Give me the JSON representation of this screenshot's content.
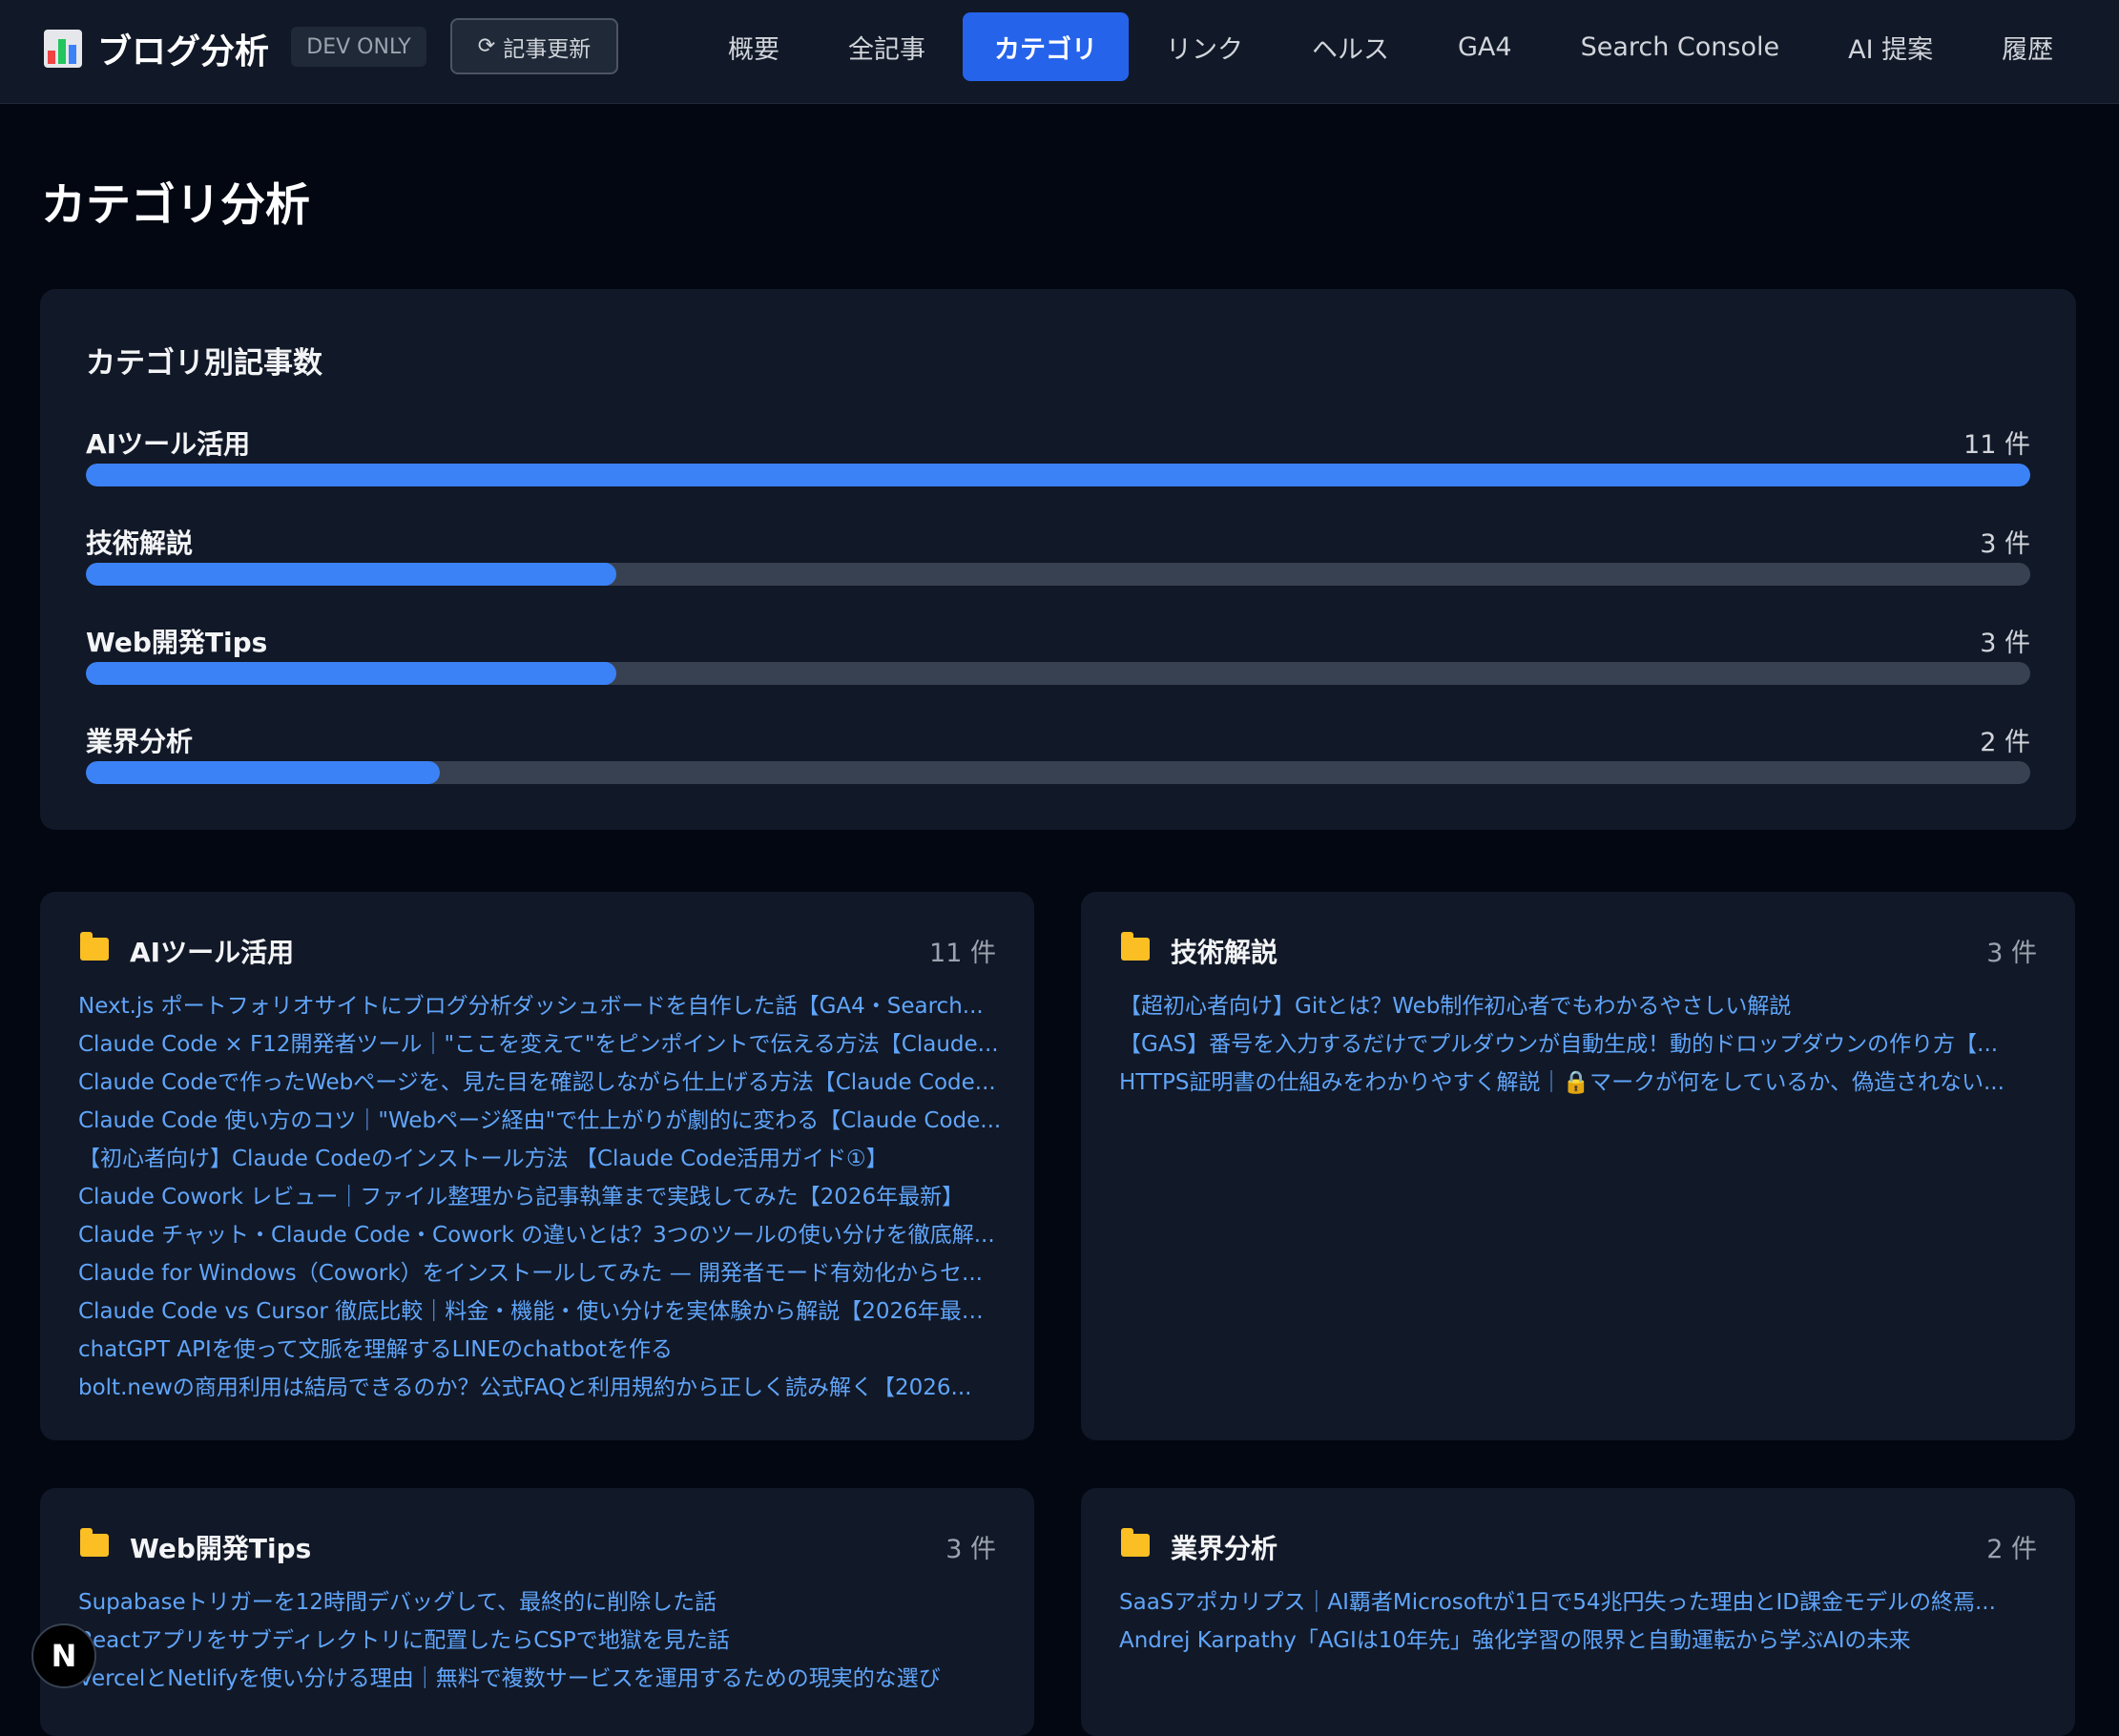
{
  "header": {
    "title": "ブログ分析",
    "dev_badge": "DEV ONLY",
    "refresh_label": "記事更新",
    "tabs": [
      {
        "label": "概要",
        "active": false
      },
      {
        "label": "全記事",
        "active": false
      },
      {
        "label": "カテゴリ",
        "active": true
      },
      {
        "label": "リンク",
        "active": false
      },
      {
        "label": "ヘルス",
        "active": false
      },
      {
        "label": "GA4",
        "active": false
      },
      {
        "label": "Search Console",
        "active": false
      },
      {
        "label": "AI 提案",
        "active": false
      },
      {
        "label": "履歴",
        "active": false
      }
    ]
  },
  "page": {
    "title": "カテゴリ分析"
  },
  "category_chart": {
    "title": "カテゴリ別記事数",
    "max": 11,
    "rows": [
      {
        "name": "AIツール活用",
        "count": 11,
        "count_label": "11 件"
      },
      {
        "name": "技術解説",
        "count": 3,
        "count_label": "3 件"
      },
      {
        "name": "Web開発Tips",
        "count": 3,
        "count_label": "3 件"
      },
      {
        "name": "業界分析",
        "count": 2,
        "count_label": "2 件"
      }
    ]
  },
  "categories": [
    {
      "name": "AIツール活用",
      "count_label": "11 件",
      "articles": [
        "Next.js ポートフォリオサイトにブログ分析ダッシュボードを自作した話【GA4・Search...",
        "Claude Code × F12開発者ツール｜\"ここを変えて\"をピンポイントで伝える方法【Claude...",
        "Claude Codeで作ったWebページを、見た目を確認しながら仕上げる方法【Claude Code...",
        "Claude Code 使い方のコツ｜\"Webページ経由\"で仕上がりが劇的に変わる【Claude Code...",
        "【初心者向け】Claude Codeのインストール方法 【Claude Code活用ガイド①】",
        "Claude Cowork レビュー｜ファイル整理から記事執筆まで実践してみた【2026年最新】",
        "Claude チャット・Claude Code・Cowork の違いとは？3つのツールの使い分けを徹底解...",
        "Claude for Windows（Cowork）をインストールしてみた — 開発者モード有効化からセ...",
        "Claude Code vs Cursor 徹底比較｜料金・機能・使い分けを実体験から解説【2026年最新】",
        "chatGPT APIを使って文脈を理解するLINEのchatbotを作る",
        "bolt.newの商用利用は結局できるのか？公式FAQと利用規約から正しく読み解く【2026..."
      ]
    },
    {
      "name": "技術解説",
      "count_label": "3 件",
      "articles": [
        "【超初心者向け】Gitとは？Web制作初心者でもわかるやさしい解説",
        "【GAS】番号を入力するだけでプルダウンが自動生成！動的ドロップダウンの作り方【...",
        "HTTPS証明書の仕組みをわかりやすく解説｜🔒マークが何をしているか、偽造されない..."
      ]
    },
    {
      "name": "Web開発Tips",
      "count_label": "3 件",
      "articles": [
        "Supabaseトリガーを12時間デバッグして、最終的に削除した話",
        "Reactアプリをサブディレクトリに配置したらCSPで地獄を見た話",
        "VercelとNetlifyを使い分ける理由｜無料で複数サービスを運用するための現実的な選び"
      ]
    },
    {
      "name": "業界分析",
      "count_label": "2 件",
      "articles": [
        "SaaSアポカリプス｜AI覇者Microsoftが1日で54兆円失った理由とID課金モデルの終焉...",
        "Andrej Karpathy「AGIは10年先」強化学習の限界と自動運転から学ぶAIの未来"
      ]
    }
  ],
  "next_badge": "N",
  "colors": {
    "accent": "#2563eb",
    "bar": "#3b82f6",
    "link": "#60a5fa",
    "folder": "#fbbf24"
  }
}
